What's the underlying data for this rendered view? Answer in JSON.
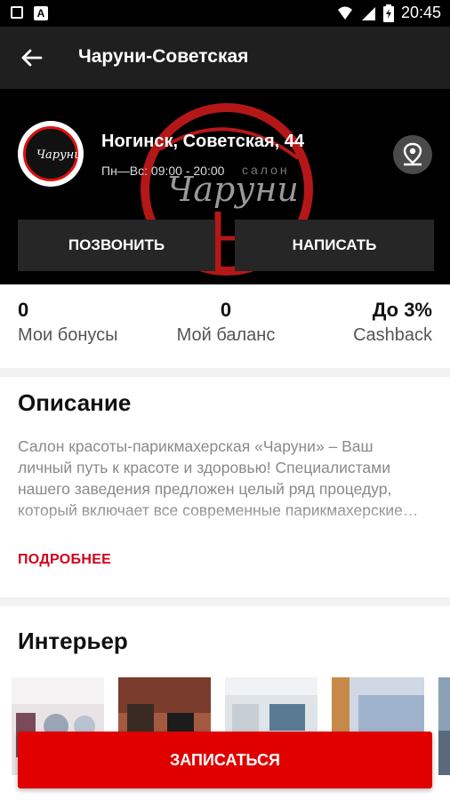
{
  "status": {
    "time": "20:45",
    "app_badge": "A"
  },
  "appbar": {
    "title": "Чаруни-Советская"
  },
  "salon": {
    "address": "Ногинск, Советская, 44",
    "hours": "Пн—Вс: 09:00 - 20:00",
    "logo_text": "Чаруни",
    "watermark_text": "Чаруни",
    "watermark_small": "салон"
  },
  "actions": {
    "call": "ПОЗВОНИТЬ",
    "write": "НАПИСАТЬ"
  },
  "stats": [
    {
      "value": "0",
      "label": "Мои бонусы"
    },
    {
      "value": "0",
      "label": "Мой баланс"
    },
    {
      "value": "До 3%",
      "label": "Cashback"
    }
  ],
  "description": {
    "heading": "Описание",
    "text": "Салон красоты-парикмахерская «Чаруни» – Ваш личный путь к красоте и здоровью! Специалистами нашего заведения предложен целый ряд процедур, который включает все современные парикмахерские…",
    "more": "ПОДРОБНЕЕ"
  },
  "interior": {
    "heading": "Интерьер"
  },
  "book": {
    "label": "ЗАПИСАТЬСЯ"
  },
  "colors": {
    "accent": "#e00000",
    "dark": "#000000",
    "appbar": "#1f1f1f"
  }
}
